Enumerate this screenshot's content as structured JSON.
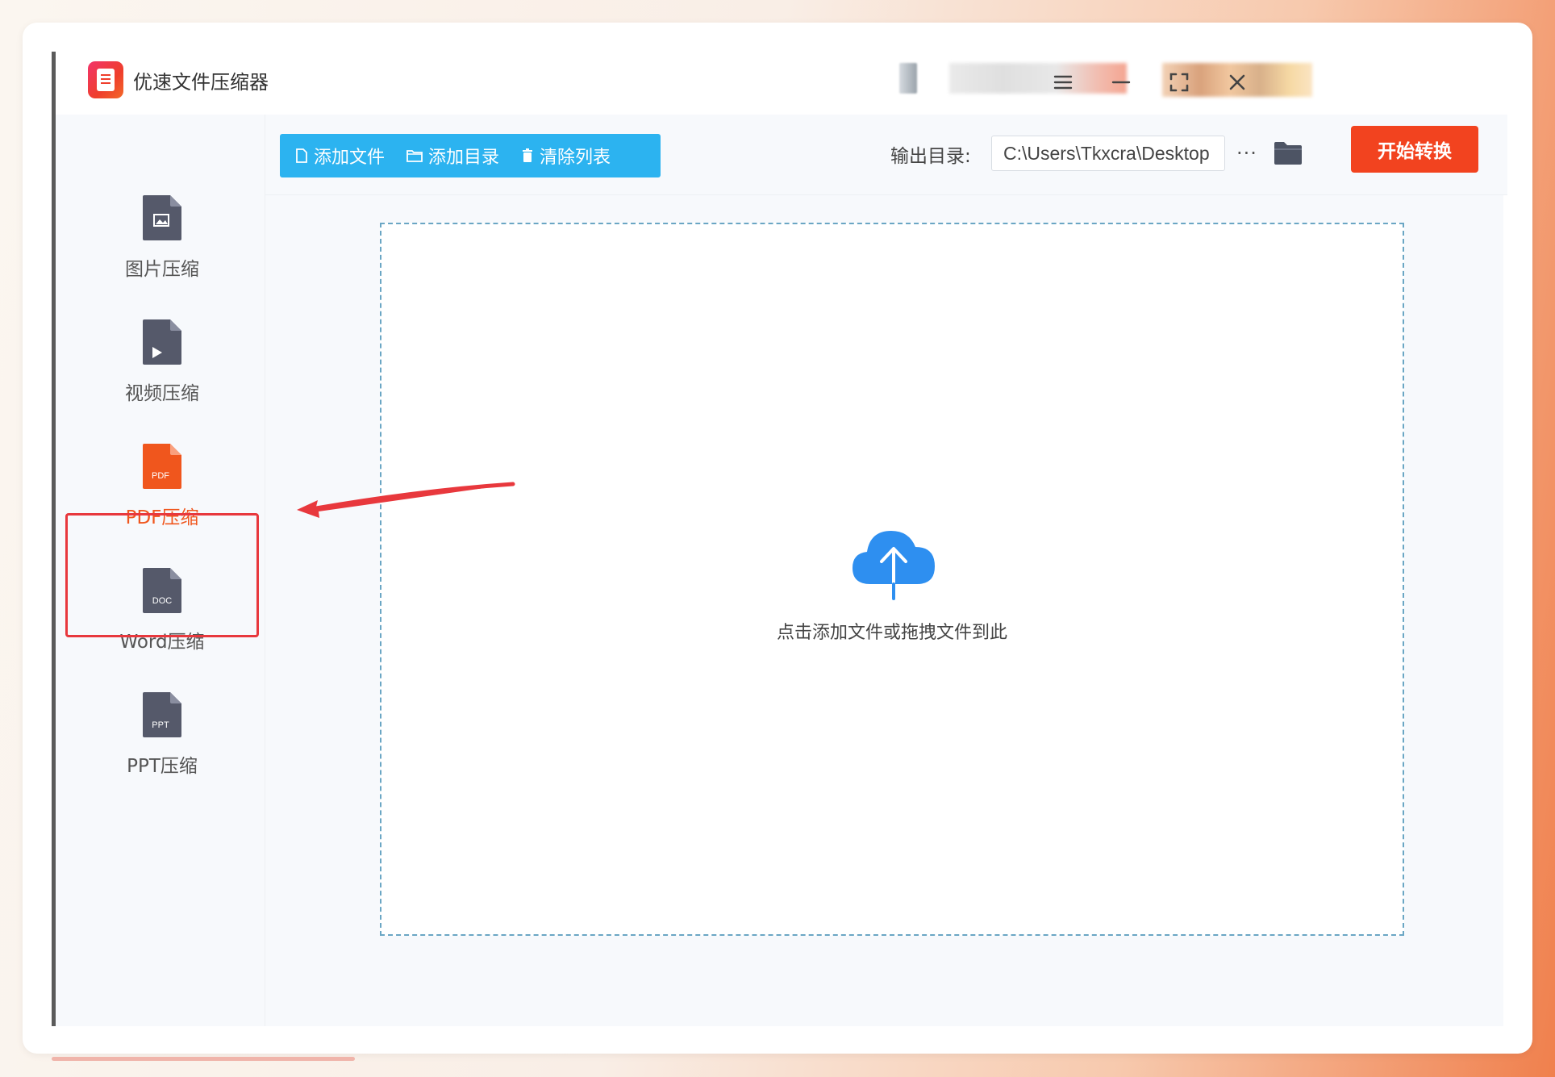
{
  "app": {
    "title": "优速文件压缩器"
  },
  "sidebar": {
    "items": [
      {
        "label": "图片压缩",
        "icon": "image-file-icon",
        "badge": ""
      },
      {
        "label": "视频压缩",
        "icon": "video-file-icon",
        "badge": ""
      },
      {
        "label": "PDF压缩",
        "icon": "pdf-file-icon",
        "badge": "PDF",
        "active": true
      },
      {
        "label": "Word压缩",
        "icon": "doc-file-icon",
        "badge": "DOC"
      },
      {
        "label": "PPT压缩",
        "icon": "ppt-file-icon",
        "badge": "PPT"
      }
    ]
  },
  "toolbar": {
    "add_file": "添加文件",
    "add_folder": "添加目录",
    "clear_list": "清除列表",
    "output_label": "输出目录:",
    "output_path": "C:\\Users\\Tkxcra\\Desktop",
    "more": "···",
    "start": "开始转换"
  },
  "dropzone": {
    "hint": "点击添加文件或拖拽文件到此"
  },
  "colors": {
    "accent_blue": "#2cb3f0",
    "start_red": "#f2431f",
    "active_orange": "#f0561d",
    "annotation_red": "#e8383d",
    "icon_gray": "#55596a"
  }
}
